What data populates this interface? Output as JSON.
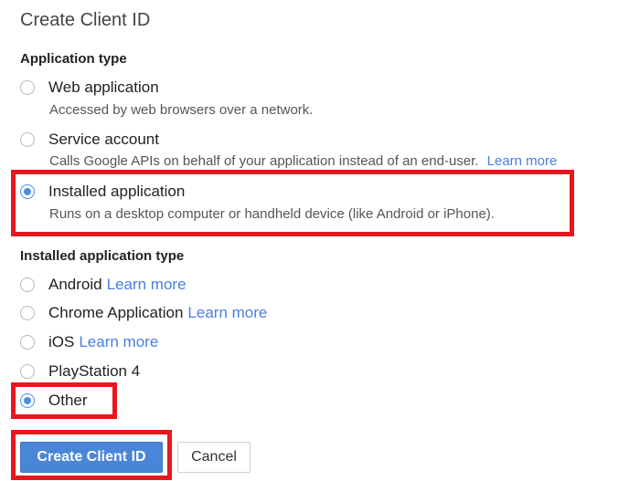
{
  "dialog": {
    "title": "Create Client ID"
  },
  "application_type": {
    "heading": "Application type",
    "options": [
      {
        "label": "Web application",
        "description": "Accessed by web browsers over a network.",
        "selected": false
      },
      {
        "label": "Service account",
        "description": "Calls Google APIs on behalf of your application instead of an end-user.",
        "link": "Learn more",
        "selected": false
      },
      {
        "label": "Installed application",
        "description": "Runs on a desktop computer or handheld device (like Android or iPhone).",
        "selected": true
      }
    ]
  },
  "installed_application_type": {
    "heading": "Installed application type",
    "options": [
      {
        "label": "Android",
        "link": "Learn more",
        "selected": false
      },
      {
        "label": "Chrome Application",
        "link": "Learn more",
        "selected": false
      },
      {
        "label": "iOS",
        "link": "Learn more",
        "selected": false
      },
      {
        "label": "PlayStation 4",
        "selected": false
      },
      {
        "label": "Other",
        "selected": true
      }
    ]
  },
  "actions": {
    "create_label": "Create Client ID",
    "cancel_label": "Cancel"
  },
  "colors": {
    "accent": "#4a86d8",
    "link": "#4a7ee0",
    "highlight": "#e8171d"
  }
}
